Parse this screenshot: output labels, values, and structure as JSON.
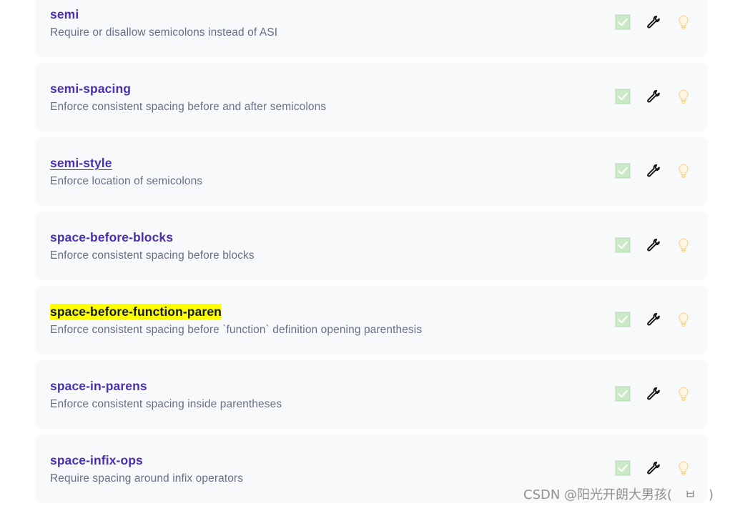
{
  "rules": [
    {
      "name": "semi",
      "description": "Require or disallow semicolons instead of ASI",
      "style": "normal"
    },
    {
      "name": "semi-spacing",
      "description": "Enforce consistent spacing before and after semicolons",
      "style": "normal"
    },
    {
      "name": "semi-style",
      "description": "Enforce location of semicolons",
      "style": "underline"
    },
    {
      "name": "space-before-blocks",
      "description": "Enforce consistent spacing before blocks",
      "style": "normal"
    },
    {
      "name": "space-before-function-paren",
      "description": "Enforce consistent spacing before `function` definition opening parenthesis",
      "style": "highlight"
    },
    {
      "name": "space-in-parens",
      "description": "Enforce consistent spacing inside parentheses",
      "style": "normal"
    },
    {
      "name": "space-infix-ops",
      "description": "Require spacing around infix operators",
      "style": "normal"
    }
  ],
  "icons": {
    "recommended": "check-square-icon",
    "fixable": "wrench-icon",
    "suggestion": "lightbulb-icon"
  },
  "colors": {
    "link": "#4a2fb0",
    "description": "#667085",
    "card_background": "#f8f9fb",
    "highlight": "#ffff00",
    "check_fill": "#c9e9c8",
    "bulb": "#f3d9a4"
  },
  "watermark": "CSDN @阳光开朗大男孩(   ㅂ   )"
}
